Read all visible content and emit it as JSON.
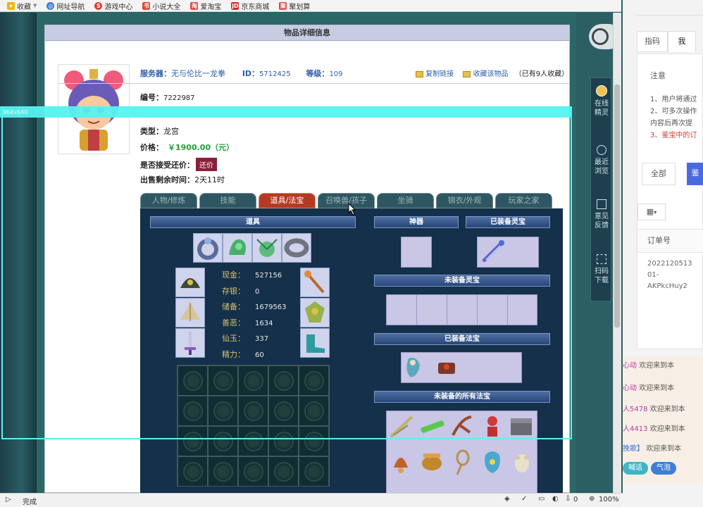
{
  "browser": {
    "bookmarks": [
      {
        "label": "收藏",
        "icon": "star-icon",
        "color": "#f3b400"
      },
      {
        "label": "网址导航",
        "icon": "globe-icon",
        "color": "#3b79d6"
      },
      {
        "label": "游戏中心",
        "icon": "game-icon",
        "color": "#e03a2e"
      },
      {
        "label": "小说大全",
        "icon": "book-icon",
        "color": "#e0432e"
      },
      {
        "label": "爱淘宝",
        "icon": "taobao-icon",
        "color": "#e04545"
      },
      {
        "label": "京东商城",
        "icon": "jd-icon",
        "color": "#d3262a"
      },
      {
        "label": "聚划算",
        "icon": "juhuasuan-icon",
        "color": "#e0484d"
      }
    ],
    "status": "完成",
    "zoom": "100%",
    "download_count": "0"
  },
  "page": {
    "header": "物品详细信息",
    "server_label": "服务器：",
    "server_value": "无与伦比一龙拳",
    "id_label": "ID：",
    "id_value": "5712425",
    "level_label": "等级：",
    "level_value": "109",
    "copy_link": "复制链接",
    "favorite": "收藏该物品",
    "fav_count": "（已有9人收藏）",
    "number_label": "编号：",
    "number_value": "7222987",
    "type_label": "类型：",
    "type_value": "龙宫",
    "price_label": "价格：",
    "price_value": "￥1900.00（元）",
    "bargain_label": "是否接受还价：",
    "bargain_button": "还价",
    "remaining_label": "出售剩余时间：",
    "remaining_value": "2天11时",
    "overlay_label": "964x640"
  },
  "tabs": [
    "人物/修炼",
    "技能",
    "道具/法宝",
    "召唤兽/孩子",
    "坐骑",
    "锦衣/外观",
    "玩家之家"
  ],
  "active_tab": 2,
  "panel": {
    "items_header": "道具",
    "artifact_header": "神器",
    "equipped_spirit_header": "已装备灵宝",
    "unequipped_spirit_header": "未装备灵宝",
    "equipped_magic_header": "已装备法宝",
    "all_magic_header": "未装备的所有法宝",
    "stats": [
      {
        "label": "现金：",
        "value": "527156"
      },
      {
        "label": "存银：",
        "value": "0"
      },
      {
        "label": "储备：",
        "value": "1679563"
      },
      {
        "label": "善恶：",
        "value": "1634"
      },
      {
        "label": "仙玉：",
        "value": "337"
      },
      {
        "label": "精力：",
        "value": "60"
      }
    ]
  },
  "right_sidebar": [
    {
      "label": "在线\n精灵",
      "icon": "avatar-icon"
    },
    {
      "label": "最近\n浏览",
      "icon": "clock-icon"
    },
    {
      "label": "意见\n反馈",
      "icon": "edit-icon"
    },
    {
      "label": "扫码\n下载",
      "icon": "qr-icon"
    }
  ],
  "right_panel": {
    "tab_labels": [
      "指码",
      "我"
    ],
    "notice_title": "注意",
    "notice_lines": [
      "1、用户将通过",
      "2、可多次操作",
      "内容后再次提",
      "3、鉴宝中的订"
    ],
    "filter_all": "全部",
    "filter_other": "鉴",
    "order_header": "订单号",
    "order_value": "2022120513\n01-\nAKPkcHuy2",
    "chat": [
      {
        "user": "心动",
        "msg": "欢迎来到本"
      },
      {
        "user": "人5478",
        "msg": "欢迎来到本"
      },
      {
        "user": "人4413",
        "msg": "欢迎来到本"
      },
      {
        "user": "挽歌】",
        "msg": "欢迎来到本"
      }
    ],
    "chat_buttons": [
      "喊话",
      "气泡"
    ]
  }
}
